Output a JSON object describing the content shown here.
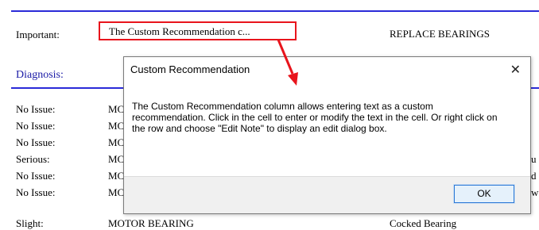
{
  "header": {
    "important_label": "Important:",
    "recommendation_text": "The Custom Recommendation c...",
    "replace_text": "REPLACE BEARINGS",
    "diagnosis_label": "Diagnosis:"
  },
  "rows": [
    {
      "label": "No Issue:",
      "mid": "MC",
      "right": ""
    },
    {
      "label": "No Issue:",
      "mid": "MC",
      "right": ""
    },
    {
      "label": "No Issue:",
      "mid": "MC",
      "right": ""
    },
    {
      "label": "Serious:",
      "mid": "MC",
      "right": "u"
    },
    {
      "label": "No Issue:",
      "mid": "MC",
      "right": "d"
    },
    {
      "label": "No Issue:",
      "mid": "MC",
      "right": "w"
    },
    {
      "label": "Slight:",
      "mid": "MOTOR BEARING",
      "right": "Cocked Bearing"
    }
  ],
  "dialog": {
    "title": "Custom Recommendation",
    "close_glyph": "✕",
    "message": "The Custom Recommendation column allows entering text as a custom recommendation. Click in the cell to enter or modify the text in the cell. Or right click on the row and choose \"Edit Note\" to display an edit dialog box.",
    "ok_label": "OK"
  },
  "colors": {
    "accent_rule": "#2a2ad8",
    "highlight_box": "#e8141c",
    "diagnosis_text": "#1a1aa6"
  }
}
